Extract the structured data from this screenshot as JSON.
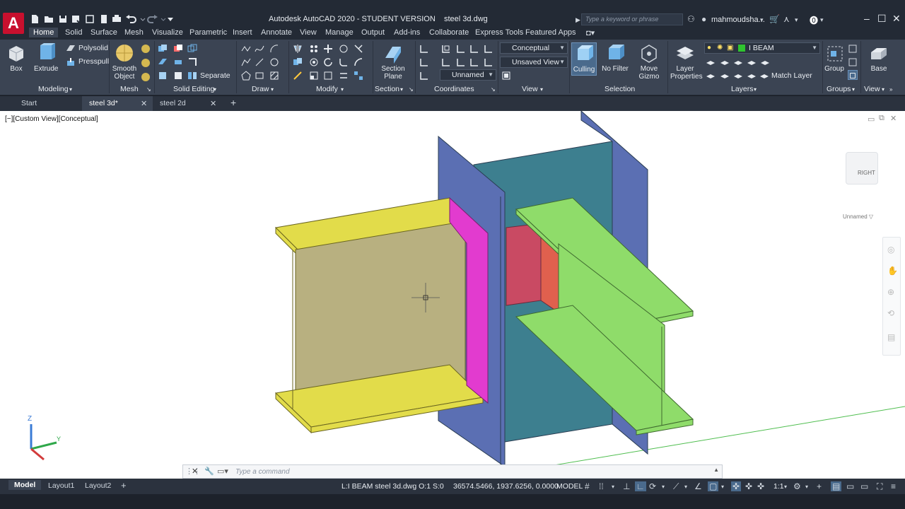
{
  "app": {
    "logo_letter": "A",
    "title": "Autodesk AutoCAD 2020 - STUDENT VERSION    steel 3d.dwg",
    "search_placeholder": "Type a keyword or phrase",
    "user_name": "mahmoudsha...",
    "accent_color": "#c8102e"
  },
  "ribbon_tabs": [
    "Home",
    "Solid",
    "Surface",
    "Mesh",
    "Visualize",
    "Parametric",
    "Insert",
    "Annotate",
    "View",
    "Manage",
    "Output",
    "Add-ins",
    "Collaborate",
    "Express Tools",
    "Featured Apps"
  ],
  "ribbon": {
    "box": "Box",
    "extrude": "Extrude",
    "polysolid": "Polysolid",
    "presspull": "Presspull",
    "smooth_object_1": "Smooth",
    "smooth_object_2": "Object",
    "separate": "Separate",
    "section_plane_1": "Section",
    "section_plane_2": "Plane",
    "visual_style": "Conceptual",
    "named_view": "Unsaved View",
    "ucs_name": "Unnamed",
    "culling": "Culling",
    "no_filter": "No Filter",
    "move_gizmo_1": "Move",
    "move_gizmo_2": "Gizmo",
    "layer_properties_1": "Layer",
    "layer_properties_2": "Properties",
    "current_layer": "I BEAM",
    "match_layer": "Match Layer",
    "group": "Group",
    "base": "Base",
    "panels": [
      "Modeling",
      "Mesh",
      "Solid Editing",
      "Draw",
      "Modify",
      "Section",
      "Coordinates",
      "View",
      "Selection",
      "Layers",
      "Groups",
      "View"
    ]
  },
  "doc_tabs": [
    {
      "label": "Start"
    },
    {
      "label": "steel 3d*"
    },
    {
      "label": "steel 2d"
    }
  ],
  "viewport": {
    "label": "[−][Custom View][Conceptual]",
    "viewcube_face": "RIGHT",
    "named_view_label": "Unnamed ▽",
    "axis_z": "Z",
    "axis_y": "Y",
    "colors": {
      "column_plate": "#5b6fb3",
      "column_web": "#3d7f8f",
      "yellow_beam": "#e2dc4a",
      "yellow_web": "#b8b080",
      "magenta_plate": "#e23bcf",
      "green_beam": "#8fdc6a",
      "red_plate": "#c94a63"
    }
  },
  "command": {
    "placeholder": "Type a command"
  },
  "status": {
    "tabs": [
      "Model",
      "Layout1",
      "Layout2"
    ],
    "layer_info": "L:I BEAM steel 3d.dwg O:1 S:0",
    "coordinates": "36574.5466, 1937.6256, 0.0000",
    "space": "MODEL",
    "scale": "1:1"
  }
}
